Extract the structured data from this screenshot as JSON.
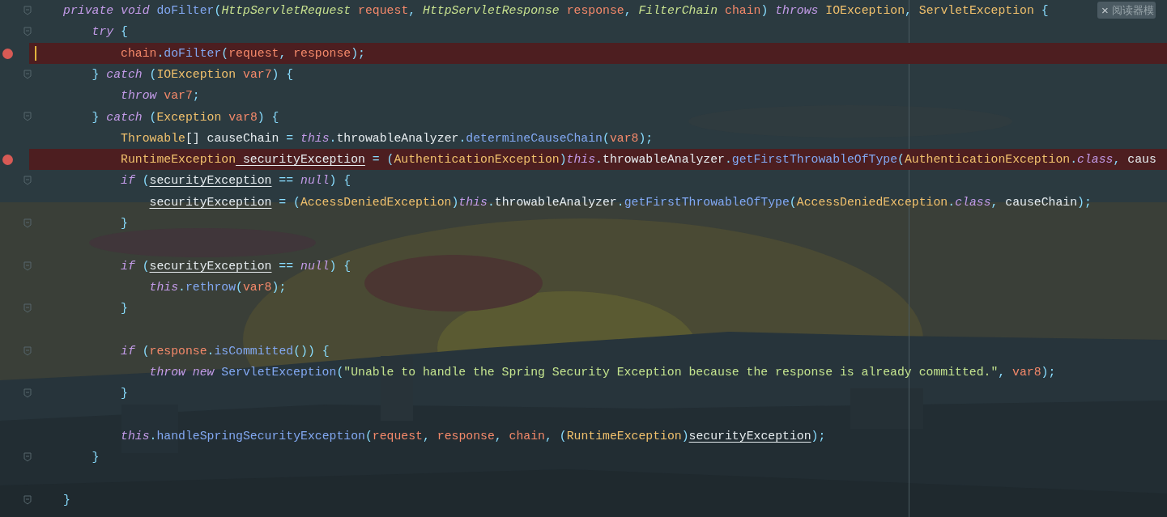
{
  "reader_mode_badge": {
    "close": "×",
    "label": "阅读器模"
  },
  "lines": [
    {
      "fold": true,
      "breakpoint": false,
      "caret": false,
      "tokens": [
        {
          "text": "private void ",
          "kind": "keyword"
        },
        {
          "text": "doFilter",
          "kind": "method"
        },
        {
          "text": "(",
          "kind": "punct"
        },
        {
          "text": "HttpServletRequest",
          "kind": "interface"
        },
        {
          "text": " request",
          "kind": "param"
        },
        {
          "text": ", ",
          "kind": "punct"
        },
        {
          "text": "HttpServletResponse",
          "kind": "interface"
        },
        {
          "text": " response",
          "kind": "param"
        },
        {
          "text": ", ",
          "kind": "punct"
        },
        {
          "text": "FilterChain",
          "kind": "interface"
        },
        {
          "text": " chain",
          "kind": "param"
        },
        {
          "text": ") ",
          "kind": "punct"
        },
        {
          "text": "throws ",
          "kind": "keyword"
        },
        {
          "text": "IOException",
          "kind": "type"
        },
        {
          "text": ", ",
          "kind": "punct"
        },
        {
          "text": "ServletException",
          "kind": "type"
        },
        {
          "text": " {",
          "kind": "punct"
        }
      ],
      "children": [
        {
          "fold": true,
          "breakpoint": false,
          "caret": false,
          "tokens": [
            {
              "text": "try",
              "kind": "keyword"
            },
            {
              "text": " {",
              "kind": "punct"
            }
          ],
          "children": [
            {
              "fold": false,
              "breakpoint": true,
              "caret": true,
              "tokens": [
                {
                  "text": "chain",
                  "kind": "param"
                },
                {
                  "text": ".",
                  "kind": "punct"
                },
                {
                  "text": "doFilter",
                  "kind": "method"
                },
                {
                  "text": "(",
                  "kind": "punct"
                },
                {
                  "text": "request",
                  "kind": "param"
                },
                {
                  "text": ", ",
                  "kind": "punct"
                },
                {
                  "text": "response",
                  "kind": "param"
                },
                {
                  "text": ");",
                  "kind": "punct"
                }
              ]
            }
          ]
        },
        {
          "fold": true,
          "breakpoint": false,
          "caret": false,
          "tokens": [
            {
              "text": "} ",
              "kind": "punct"
            },
            {
              "text": "catch",
              "kind": "keyword"
            },
            {
              "text": " (",
              "kind": "punct"
            },
            {
              "text": "IOException",
              "kind": "type"
            },
            {
              "text": " var7",
              "kind": "param"
            },
            {
              "text": ") {",
              "kind": "punct"
            }
          ],
          "children": [
            {
              "fold": false,
              "breakpoint": false,
              "caret": false,
              "tokens": [
                {
                  "text": "throw ",
                  "kind": "keyword"
                },
                {
                  "text": "var7",
                  "kind": "param"
                },
                {
                  "text": ";",
                  "kind": "punct"
                }
              ]
            }
          ]
        },
        {
          "fold": true,
          "breakpoint": false,
          "caret": false,
          "tokens": [
            {
              "text": "} ",
              "kind": "punct"
            },
            {
              "text": "catch",
              "kind": "keyword"
            },
            {
              "text": " (",
              "kind": "punct"
            },
            {
              "text": "Exception",
              "kind": "type"
            },
            {
              "text": " var8",
              "kind": "param"
            },
            {
              "text": ") {",
              "kind": "punct"
            }
          ],
          "children": [
            {
              "fold": false,
              "breakpoint": false,
              "caret": false,
              "tokens": [
                {
                  "text": "Throwable",
                  "kind": "type"
                },
                {
                  "text": "[] causeChain ",
                  "kind": "plain"
                },
                {
                  "text": "= ",
                  "kind": "punct"
                },
                {
                  "text": "this",
                  "kind": "keyword"
                },
                {
                  "text": ".",
                  "kind": "punct"
                },
                {
                  "text": "throwableAnalyzer",
                  "kind": "plain"
                },
                {
                  "text": ".",
                  "kind": "punct"
                },
                {
                  "text": "determineCauseChain",
                  "kind": "method"
                },
                {
                  "text": "(",
                  "kind": "punct"
                },
                {
                  "text": "var8",
                  "kind": "param"
                },
                {
                  "text": ");",
                  "kind": "punct"
                }
              ]
            },
            {
              "fold": false,
              "breakpoint": true,
              "caret": false,
              "tokens": [
                {
                  "text": "RuntimeException",
                  "kind": "type"
                },
                {
                  "text": " securityException",
                  "kind": "reassigned"
                },
                {
                  "text": " = (",
                  "kind": "punct"
                },
                {
                  "text": "AuthenticationException",
                  "kind": "type"
                },
                {
                  "text": ")",
                  "kind": "punct"
                },
                {
                  "text": "this",
                  "kind": "keyword"
                },
                {
                  "text": ".",
                  "kind": "punct"
                },
                {
                  "text": "throwableAnalyzer",
                  "kind": "plain"
                },
                {
                  "text": ".",
                  "kind": "punct"
                },
                {
                  "text": "getFirstThrowableOfType",
                  "kind": "method"
                },
                {
                  "text": "(",
                  "kind": "punct"
                },
                {
                  "text": "AuthenticationException",
                  "kind": "type"
                },
                {
                  "text": ".",
                  "kind": "punct"
                },
                {
                  "text": "class",
                  "kind": "keyword"
                },
                {
                  "text": ", ",
                  "kind": "punct"
                },
                {
                  "text": "caus",
                  "kind": "plain"
                }
              ]
            },
            {
              "fold": true,
              "breakpoint": false,
              "caret": false,
              "tokens": [
                {
                  "text": "if",
                  "kind": "keyword"
                },
                {
                  "text": " (",
                  "kind": "punct"
                },
                {
                  "text": "securityException",
                  "kind": "reassigned"
                },
                {
                  "text": " == ",
                  "kind": "punct"
                },
                {
                  "text": "null",
                  "kind": "keyword"
                },
                {
                  "text": ") {",
                  "kind": "punct"
                }
              ],
              "children": [
                {
                  "fold": false,
                  "breakpoint": false,
                  "caret": false,
                  "tokens": [
                    {
                      "text": "securityException",
                      "kind": "reassigned"
                    },
                    {
                      "text": " = (",
                      "kind": "punct"
                    },
                    {
                      "text": "AccessDeniedException",
                      "kind": "type"
                    },
                    {
                      "text": ")",
                      "kind": "punct"
                    },
                    {
                      "text": "this",
                      "kind": "keyword"
                    },
                    {
                      "text": ".",
                      "kind": "punct"
                    },
                    {
                      "text": "throwableAnalyzer",
                      "kind": "plain"
                    },
                    {
                      "text": ".",
                      "kind": "punct"
                    },
                    {
                      "text": "getFirstThrowableOfType",
                      "kind": "method"
                    },
                    {
                      "text": "(",
                      "kind": "punct"
                    },
                    {
                      "text": "AccessDeniedException",
                      "kind": "type"
                    },
                    {
                      "text": ".",
                      "kind": "punct"
                    },
                    {
                      "text": "class",
                      "kind": "keyword"
                    },
                    {
                      "text": ", ",
                      "kind": "punct"
                    },
                    {
                      "text": "causeChain",
                      "kind": "plain"
                    },
                    {
                      "text": ");",
                      "kind": "punct"
                    }
                  ]
                }
              ]
            },
            {
              "fold": true,
              "breakpoint": false,
              "caret": false,
              "tokens": [
                {
                  "text": "}",
                  "kind": "punct"
                }
              ]
            },
            {
              "fold": false,
              "breakpoint": false,
              "caret": false
            },
            {
              "fold": true,
              "breakpoint": false,
              "caret": false,
              "tokens": [
                {
                  "text": "if",
                  "kind": "keyword"
                },
                {
                  "text": " (",
                  "kind": "punct"
                },
                {
                  "text": "securityException",
                  "kind": "reassigned"
                },
                {
                  "text": " == ",
                  "kind": "punct"
                },
                {
                  "text": "null",
                  "kind": "keyword"
                },
                {
                  "text": ") {",
                  "kind": "punct"
                }
              ],
              "children": [
                {
                  "fold": false,
                  "breakpoint": false,
                  "caret": false,
                  "tokens": [
                    {
                      "text": "this",
                      "kind": "keyword"
                    },
                    {
                      "text": ".",
                      "kind": "punct"
                    },
                    {
                      "text": "rethrow",
                      "kind": "method"
                    },
                    {
                      "text": "(",
                      "kind": "punct"
                    },
                    {
                      "text": "var8",
                      "kind": "param"
                    },
                    {
                      "text": ");",
                      "kind": "punct"
                    }
                  ]
                }
              ]
            },
            {
              "fold": true,
              "breakpoint": false,
              "caret": false,
              "tokens": [
                {
                  "text": "}",
                  "kind": "punct"
                }
              ]
            },
            {
              "fold": false,
              "breakpoint": false,
              "caret": false
            },
            {
              "fold": true,
              "breakpoint": false,
              "caret": false,
              "tokens": [
                {
                  "text": "if",
                  "kind": "keyword"
                },
                {
                  "text": " (",
                  "kind": "punct"
                },
                {
                  "text": "response",
                  "kind": "param"
                },
                {
                  "text": ".",
                  "kind": "punct"
                },
                {
                  "text": "isCommitted",
                  "kind": "method"
                },
                {
                  "text": "()) {",
                  "kind": "punct"
                }
              ],
              "children": [
                {
                  "fold": false,
                  "breakpoint": false,
                  "caret": false,
                  "tokens": [
                    {
                      "text": "throw new ",
                      "kind": "keyword"
                    },
                    {
                      "text": "ServletException",
                      "kind": "method"
                    },
                    {
                      "text": "(",
                      "kind": "punct"
                    },
                    {
                      "text": "\"Unable to handle the Spring Security Exception because the response is already committed.\"",
                      "kind": "string"
                    },
                    {
                      "text": ", ",
                      "kind": "punct"
                    },
                    {
                      "text": "var8",
                      "kind": "param"
                    },
                    {
                      "text": ");",
                      "kind": "punct"
                    }
                  ]
                }
              ]
            },
            {
              "fold": true,
              "breakpoint": false,
              "caret": false,
              "tokens": [
                {
                  "text": "}",
                  "kind": "punct"
                }
              ]
            },
            {
              "fold": false,
              "breakpoint": false,
              "caret": false
            },
            {
              "fold": false,
              "breakpoint": false,
              "caret": false,
              "tokens": [
                {
                  "text": "this",
                  "kind": "keyword"
                },
                {
                  "text": ".",
                  "kind": "punct"
                },
                {
                  "text": "handleSpringSecurityException",
                  "kind": "method"
                },
                {
                  "text": "(",
                  "kind": "punct"
                },
                {
                  "text": "request",
                  "kind": "param"
                },
                {
                  "text": ", ",
                  "kind": "punct"
                },
                {
                  "text": "response",
                  "kind": "param"
                },
                {
                  "text": ", ",
                  "kind": "punct"
                },
                {
                  "text": "chain",
                  "kind": "param"
                },
                {
                  "text": ", (",
                  "kind": "punct"
                },
                {
                  "text": "RuntimeException",
                  "kind": "type"
                },
                {
                  "text": ")",
                  "kind": "punct"
                },
                {
                  "text": "securityException",
                  "kind": "reassigned"
                },
                {
                  "text": ");",
                  "kind": "punct"
                }
              ]
            }
          ]
        },
        {
          "fold": true,
          "breakpoint": false,
          "caret": false,
          "tokens": [
            {
              "text": "}",
              "kind": "punct"
            }
          ]
        }
      ]
    },
    {
      "fold": false,
      "breakpoint": false,
      "caret": false
    },
    {
      "fold": true,
      "breakpoint": false,
      "caret": false,
      "tokens": [
        {
          "text": "}",
          "kind": "punct"
        }
      ]
    }
  ]
}
